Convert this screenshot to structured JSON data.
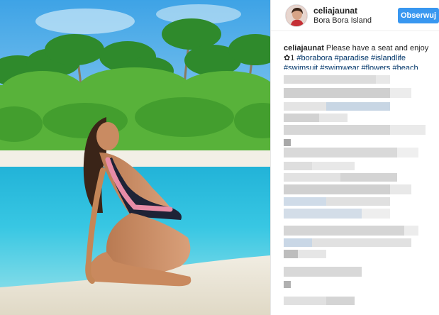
{
  "post": {
    "username": "celiajaunat",
    "location": "Bora Bora Island",
    "follow_label": "Obserwuj"
  },
  "caption": {
    "username": "celiajaunat",
    "text": "Please have a seat and enjoy",
    "emoji_line": "✿1",
    "hashtags": [
      "#borabora",
      "#paradise",
      "#islandlife",
      "#swimsuit",
      "#swimwear",
      "#flowers",
      "#beach"
    ]
  }
}
